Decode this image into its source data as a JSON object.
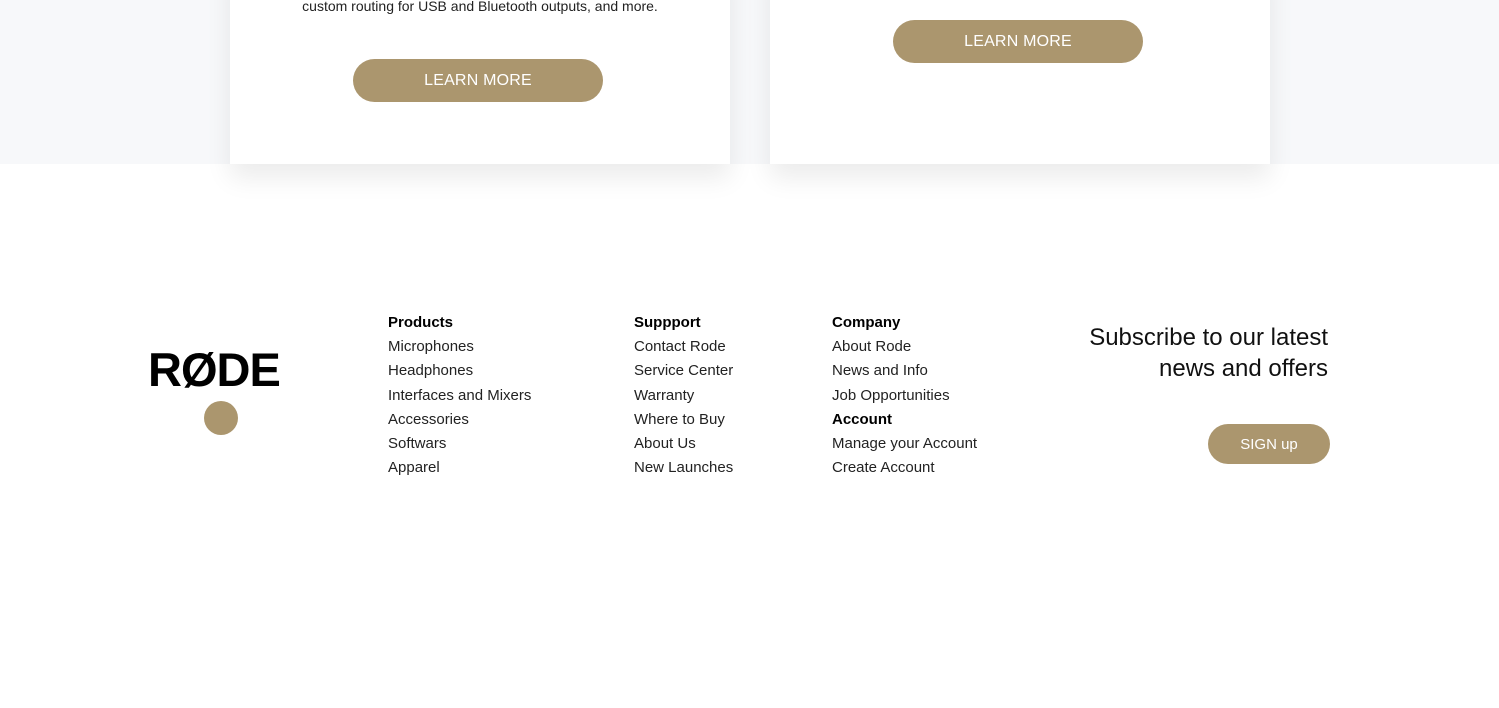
{
  "cards": [
    {
      "text": "custom routing for USB and Bluetooth outputs, and more.",
      "button_label": "LEARN MORE"
    },
    {
      "text": "",
      "button_label": "LEARN MORE"
    }
  ],
  "footer": {
    "logo_text": "RØDE",
    "products": {
      "heading": "Products",
      "links": [
        "Microphones",
        "Headphones",
        "Interfaces and Mixers",
        "Accessories",
        "Softwars",
        "Apparel"
      ]
    },
    "support": {
      "heading": "Suppport",
      "links": [
        "Contact Rode",
        "Service Center",
        "Warranty",
        "Where to Buy",
        "About Us",
        "New Launches"
      ]
    },
    "company": {
      "heading": "Company",
      "links": [
        "About Rode",
        "News and Info",
        "Job Opportunities"
      ],
      "account_heading": "Account",
      "account_links": [
        "Manage your Account",
        "Create Account"
      ]
    },
    "subscribe": {
      "title_line1": "Subscribe to our latest",
      "title_line2": "news and offers",
      "button_label": "SIGN up"
    }
  },
  "colors": {
    "accent": "#ab966e",
    "band_background": "#f7f8fa"
  }
}
